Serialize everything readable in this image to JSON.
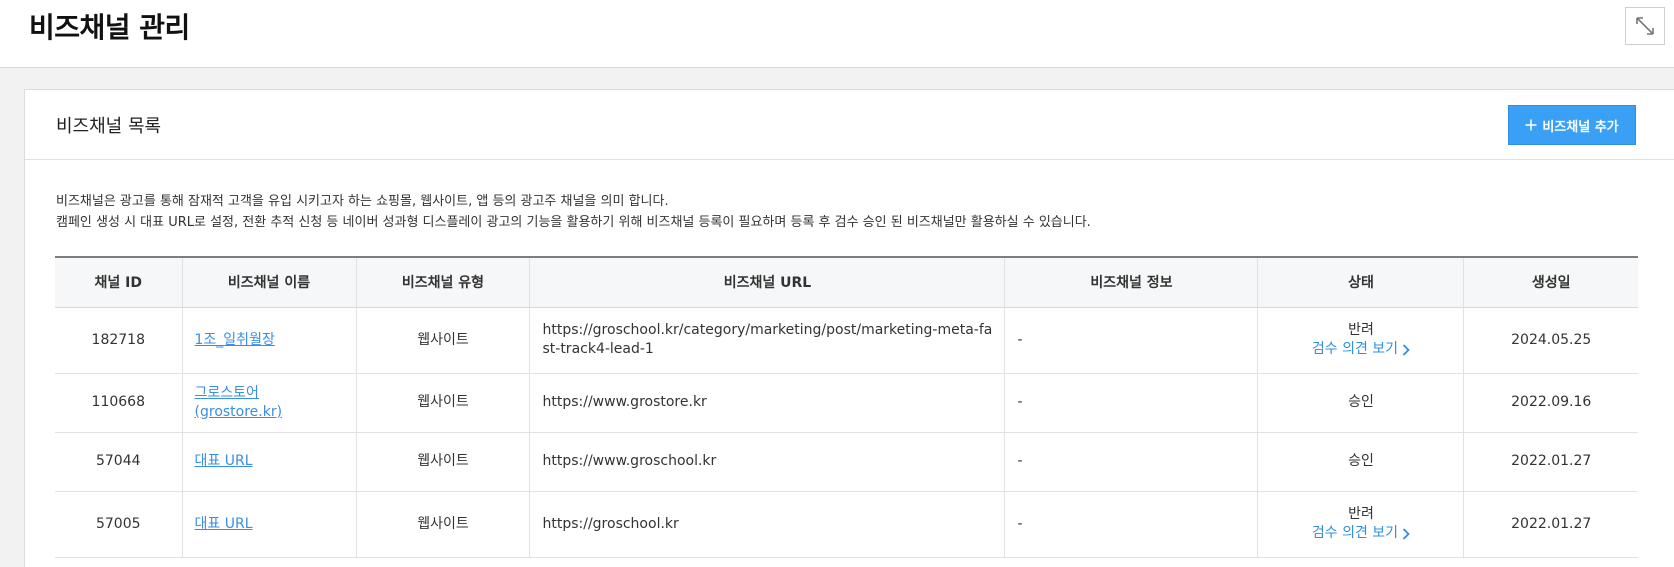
{
  "page": {
    "title": "비즈채널 관리"
  },
  "card": {
    "title": "비즈채널 목록",
    "add_button": "비즈채널 추가",
    "description": [
      "비즈채널은 광고를 통해 잠재적 고객을 유입 시키고자 하는 쇼핑몰, 웹사이트, 앱 등의 광고주 채널을 의미 합니다.",
      "캠페인 생성 시 대표 URL로 설정, 전환 추적 신청 등 네이버 성과형 디스플레이 광고의 기능을 활용하기 위해 비즈채널 등록이 필요하며 등록 후 검수 승인 된 비즈채널만 활용하실 수 있습니다."
    ]
  },
  "table": {
    "columns": [
      "채널 ID",
      "비즈채널 이름",
      "비즈채널 유형",
      "비즈채널 URL",
      "비즈채널 정보",
      "상태",
      "생성일"
    ],
    "rows": [
      {
        "id": "182718",
        "name": "1조_일취월장",
        "type": "웹사이트",
        "url": "https://groschool.kr/category/marketing/post/marketing-meta-fast-track4-lead-1",
        "info": "-",
        "status": "반려",
        "review_link": "검수 의견 보기",
        "created": "2024.05.25"
      },
      {
        "id": "110668",
        "name": "그로스토어(grostore.kr)",
        "type": "웹사이트",
        "url": "https://www.grostore.kr",
        "info": "-",
        "status": "승인",
        "created": "2022.09.16"
      },
      {
        "id": "57044",
        "name": "대표 URL",
        "type": "웹사이트",
        "url": "https://www.groschool.kr",
        "info": "-",
        "status": "승인",
        "created": "2022.01.27"
      },
      {
        "id": "57005",
        "name": "대표 URL",
        "type": "웹사이트",
        "url": "https://groschool.kr",
        "info": "-",
        "status": "반려",
        "review_link": "검수 의견 보기",
        "created": "2022.01.27"
      }
    ]
  },
  "colors": {
    "accent": "#3aa0f5",
    "link": "#3a8ee6"
  },
  "icons": {
    "expand": "expand-diagonal-icon",
    "add": "plus-icon",
    "chevron": "chevron-right-icon"
  }
}
